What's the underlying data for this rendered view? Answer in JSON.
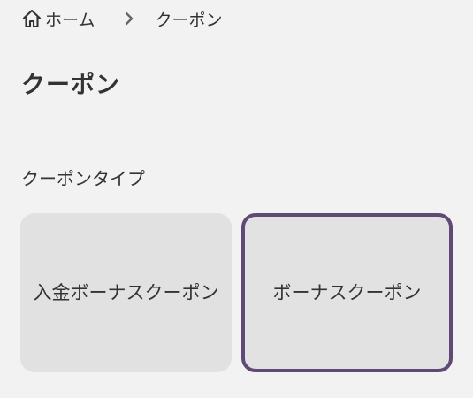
{
  "breadcrumb": {
    "home_label": "ホーム",
    "current_label": "クーポン"
  },
  "page": {
    "title": "クーポン"
  },
  "coupon_type": {
    "label": "クーポンタイプ",
    "options": [
      {
        "label": "入金ボーナスクーポン",
        "selected": false
      },
      {
        "label": "ボーナスクーポン",
        "selected": true
      }
    ]
  },
  "colors": {
    "background": "#f2f2f2",
    "card": "#e1e1e1",
    "selected_border": "#5e4a75",
    "text": "#333333"
  }
}
